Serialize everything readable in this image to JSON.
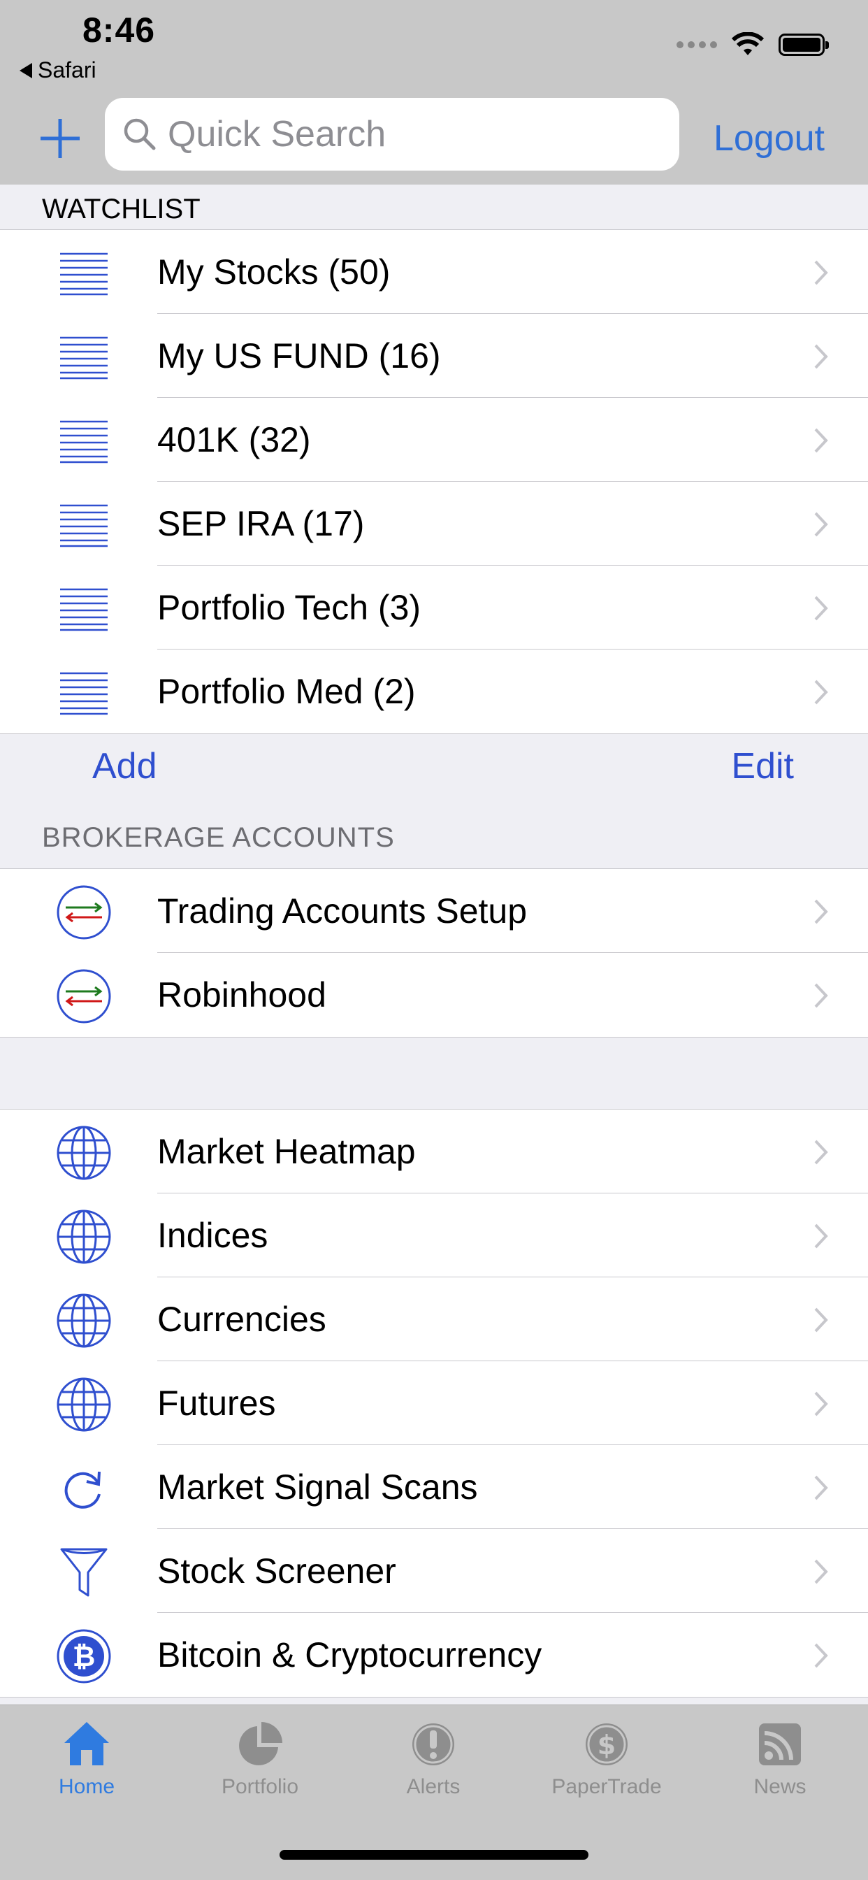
{
  "status_bar": {
    "time": "8:46",
    "back_label": "Safari"
  },
  "nav": {
    "search_placeholder": "Quick Search",
    "logout_label": "Logout"
  },
  "watchlist": {
    "header": "WATCHLIST",
    "items": [
      {
        "label": "My Stocks (50)"
      },
      {
        "label": "My US FUND (16)"
      },
      {
        "label": "401K (32)"
      },
      {
        "label": "SEP IRA (17)"
      },
      {
        "label": "Portfolio Tech (3)"
      },
      {
        "label": "Portfolio Med (2)"
      }
    ],
    "add_label": "Add",
    "edit_label": "Edit"
  },
  "brokerage": {
    "header": "BROKERAGE ACCOUNTS",
    "items": [
      {
        "label": "Trading Accounts Setup",
        "icon": "transfer-arrows-icon"
      },
      {
        "label": "Robinhood",
        "icon": "transfer-arrows-icon"
      }
    ]
  },
  "markets": {
    "items": [
      {
        "label": "Market Heatmap",
        "icon": "globe-icon"
      },
      {
        "label": "Indices",
        "icon": "globe-icon"
      },
      {
        "label": "Currencies",
        "icon": "globe-icon"
      },
      {
        "label": "Futures",
        "icon": "globe-icon"
      },
      {
        "label": "Market Signal Scans",
        "icon": "refresh-icon"
      },
      {
        "label": "Stock Screener",
        "icon": "funnel-icon"
      },
      {
        "label": "Bitcoin & Cryptocurrency",
        "icon": "bitcoin-icon"
      }
    ]
  },
  "tabs": [
    {
      "label": "Home",
      "icon": "home-icon",
      "active": true
    },
    {
      "label": "Portfolio",
      "icon": "pie-chart-icon",
      "active": false
    },
    {
      "label": "Alerts",
      "icon": "alert-icon",
      "active": false
    },
    {
      "label": "PaperTrade",
      "icon": "dollar-icon",
      "active": false
    },
    {
      "label": "News",
      "icon": "rss-icon",
      "active": false
    }
  ],
  "colors": {
    "accent": "#2f4fcf",
    "link": "#2f6fd6",
    "tab_active": "#2f7be0",
    "tab_inactive": "#8e8e8e"
  }
}
